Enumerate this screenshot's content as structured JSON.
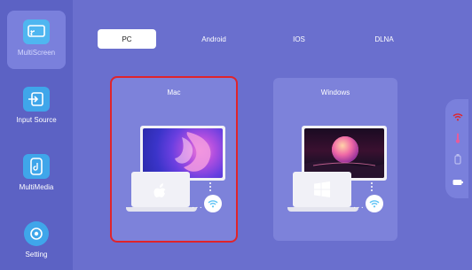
{
  "sidebar": {
    "items": [
      {
        "label": "MultiScreen",
        "icon": "screen-cast-icon",
        "active": true
      },
      {
        "label": "Input Source",
        "icon": "input-source-icon",
        "active": false
      },
      {
        "label": "MultiMedia",
        "icon": "multimedia-icon",
        "active": false
      },
      {
        "label": "Setting",
        "icon": "gear-icon",
        "active": false
      }
    ]
  },
  "tabs": [
    {
      "label": "PC",
      "active": true
    },
    {
      "label": "Android",
      "active": false
    },
    {
      "label": "IOS",
      "active": false
    },
    {
      "label": "DLNA",
      "active": false
    }
  ],
  "cards": [
    {
      "title": "Mac",
      "selected": true,
      "os_icon": "apple-icon"
    },
    {
      "title": "Windows",
      "selected": false,
      "os_icon": "windows-icon"
    }
  ],
  "right_rail": {
    "icons": [
      "wifi-icon",
      "thermometer-icon",
      "usb-icon",
      "battery-icon"
    ]
  },
  "colors": {
    "background": "#6a6fce",
    "sidebar": "#5c62c4",
    "card": "#7d82da",
    "selection": "#e0242b",
    "accent": "#5ec3f5"
  }
}
